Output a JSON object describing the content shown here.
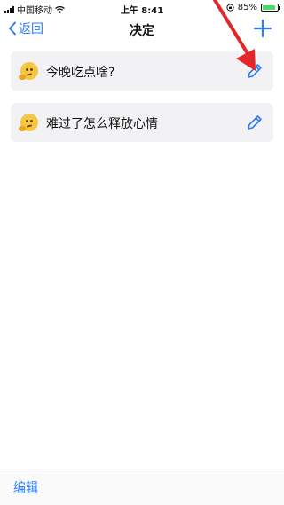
{
  "status_bar": {
    "carrier": "中国移动",
    "time": "上午 8:41",
    "battery_text": "85%",
    "battery_level": 0.85
  },
  "nav": {
    "back_label": "返回",
    "title": "决定"
  },
  "items": [
    {
      "label": "今晚吃点啥?"
    },
    {
      "label": "难过了怎么释放心情"
    }
  ],
  "bottom": {
    "edit_label": "编辑"
  },
  "colors": {
    "accent": "#2f7cf6",
    "annotation_arrow": "#e3262a",
    "card_bg": "#f2f2f5"
  }
}
